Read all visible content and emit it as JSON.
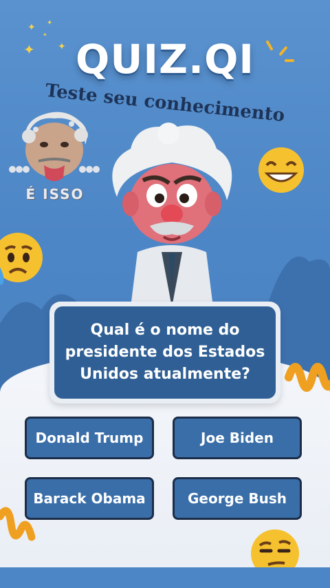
{
  "title": "QUIZ.QI",
  "subtitle": "Teste seu conhecimento",
  "sticker": {
    "label": "É ISSO"
  },
  "question": {
    "text": "Qual é o nome do presidente dos Estados Unidos atualmente?"
  },
  "answers": [
    {
      "label": "Donald Trump"
    },
    {
      "label": "Joe Biden"
    },
    {
      "label": "Barack Obama"
    },
    {
      "label": "George Bush"
    }
  ],
  "colors": {
    "background": "#4d86c6",
    "card": "#2f5f94",
    "button": "#3a6ea8",
    "button_border": "#1c2d49",
    "ground": "#eef2f7"
  },
  "icons": [
    "sparkle-icon",
    "grinning-emoji",
    "sad-emoji",
    "skeptical-emoji",
    "squiggle-decoration"
  ]
}
